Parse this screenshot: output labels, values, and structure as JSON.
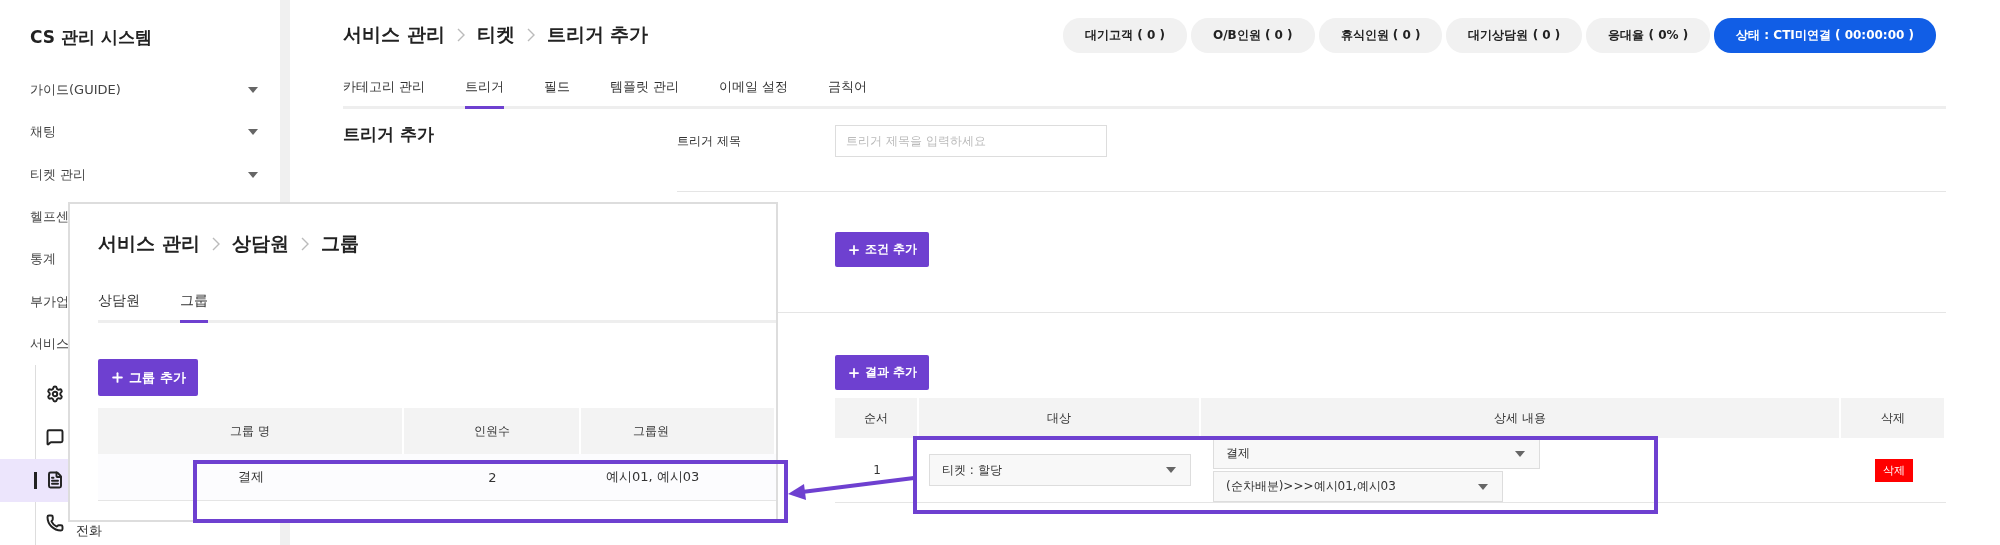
{
  "sidebar": {
    "title": "CS 관리 시스템",
    "items": [
      {
        "label": "가이드(GUIDE)",
        "expandable": true
      },
      {
        "label": "채팅",
        "expandable": true
      },
      {
        "label": "티켓 관리",
        "expandable": true
      },
      {
        "label": "헬프센",
        "expandable": false
      },
      {
        "label": "통계",
        "expandable": false
      },
      {
        "label": "부가업",
        "expandable": false
      },
      {
        "label": "서비스",
        "expandable": false
      }
    ],
    "sub_items": [
      {
        "kind": "gear",
        "selected": false
      },
      {
        "kind": "chat",
        "selected": false
      },
      {
        "kind": "document",
        "selected": true
      },
      {
        "kind": "phone",
        "label": "전화",
        "selected": false
      }
    ]
  },
  "header": {
    "breadcrumb": [
      "서비스 관리",
      "티켓",
      "트리거 추가"
    ],
    "pills": [
      {
        "kind": "count",
        "label": "대기고객 ( 0 )"
      },
      {
        "kind": "count",
        "label": "O/B인원 ( 0 )"
      },
      {
        "kind": "count",
        "label": "휴식인원 ( 0 )"
      },
      {
        "kind": "count",
        "label": "대기상담원 ( 0 )"
      },
      {
        "kind": "count",
        "label": "응대율 ( 0% )"
      },
      {
        "kind": "status",
        "label": "상태 : CTI미연결 ( 00:00:00 )"
      }
    ]
  },
  "tabs": [
    {
      "label": "카테고리 관리",
      "selected": false
    },
    {
      "label": "트리거",
      "selected": true
    },
    {
      "label": "필드",
      "selected": false
    },
    {
      "label": "템플릿 관리",
      "selected": false
    },
    {
      "label": "이메일 설정",
      "selected": false
    },
    {
      "label": "금칙어",
      "selected": false
    }
  ],
  "page_title": "트리거 추가",
  "form": {
    "title_label": "트리거 제목",
    "title_placeholder": "트리거 제목을 입력하세요",
    "condition_button": "조건 추가",
    "result_button": "결과 추가"
  },
  "result_table": {
    "columns": [
      "순서",
      "대상",
      "상세 내용",
      "삭제"
    ],
    "rows": [
      {
        "order": "1",
        "target": "티켓 : 할당",
        "details": [
          "결제",
          "(순차배분)>>>예시01,예시03"
        ],
        "delete": "삭제"
      }
    ]
  },
  "inset": {
    "breadcrumb": [
      "서비스 관리",
      "상담원",
      "그룹"
    ],
    "tabs": [
      {
        "label": "상담원",
        "selected": false
      },
      {
        "label": "그룹",
        "selected": true
      }
    ],
    "add_button": "그룹 추가",
    "columns": [
      "그룹 명",
      "인원수",
      "그룹원"
    ],
    "rows": [
      {
        "name": "결제",
        "count": "2",
        "members": "예시01, 예시03"
      }
    ]
  }
}
